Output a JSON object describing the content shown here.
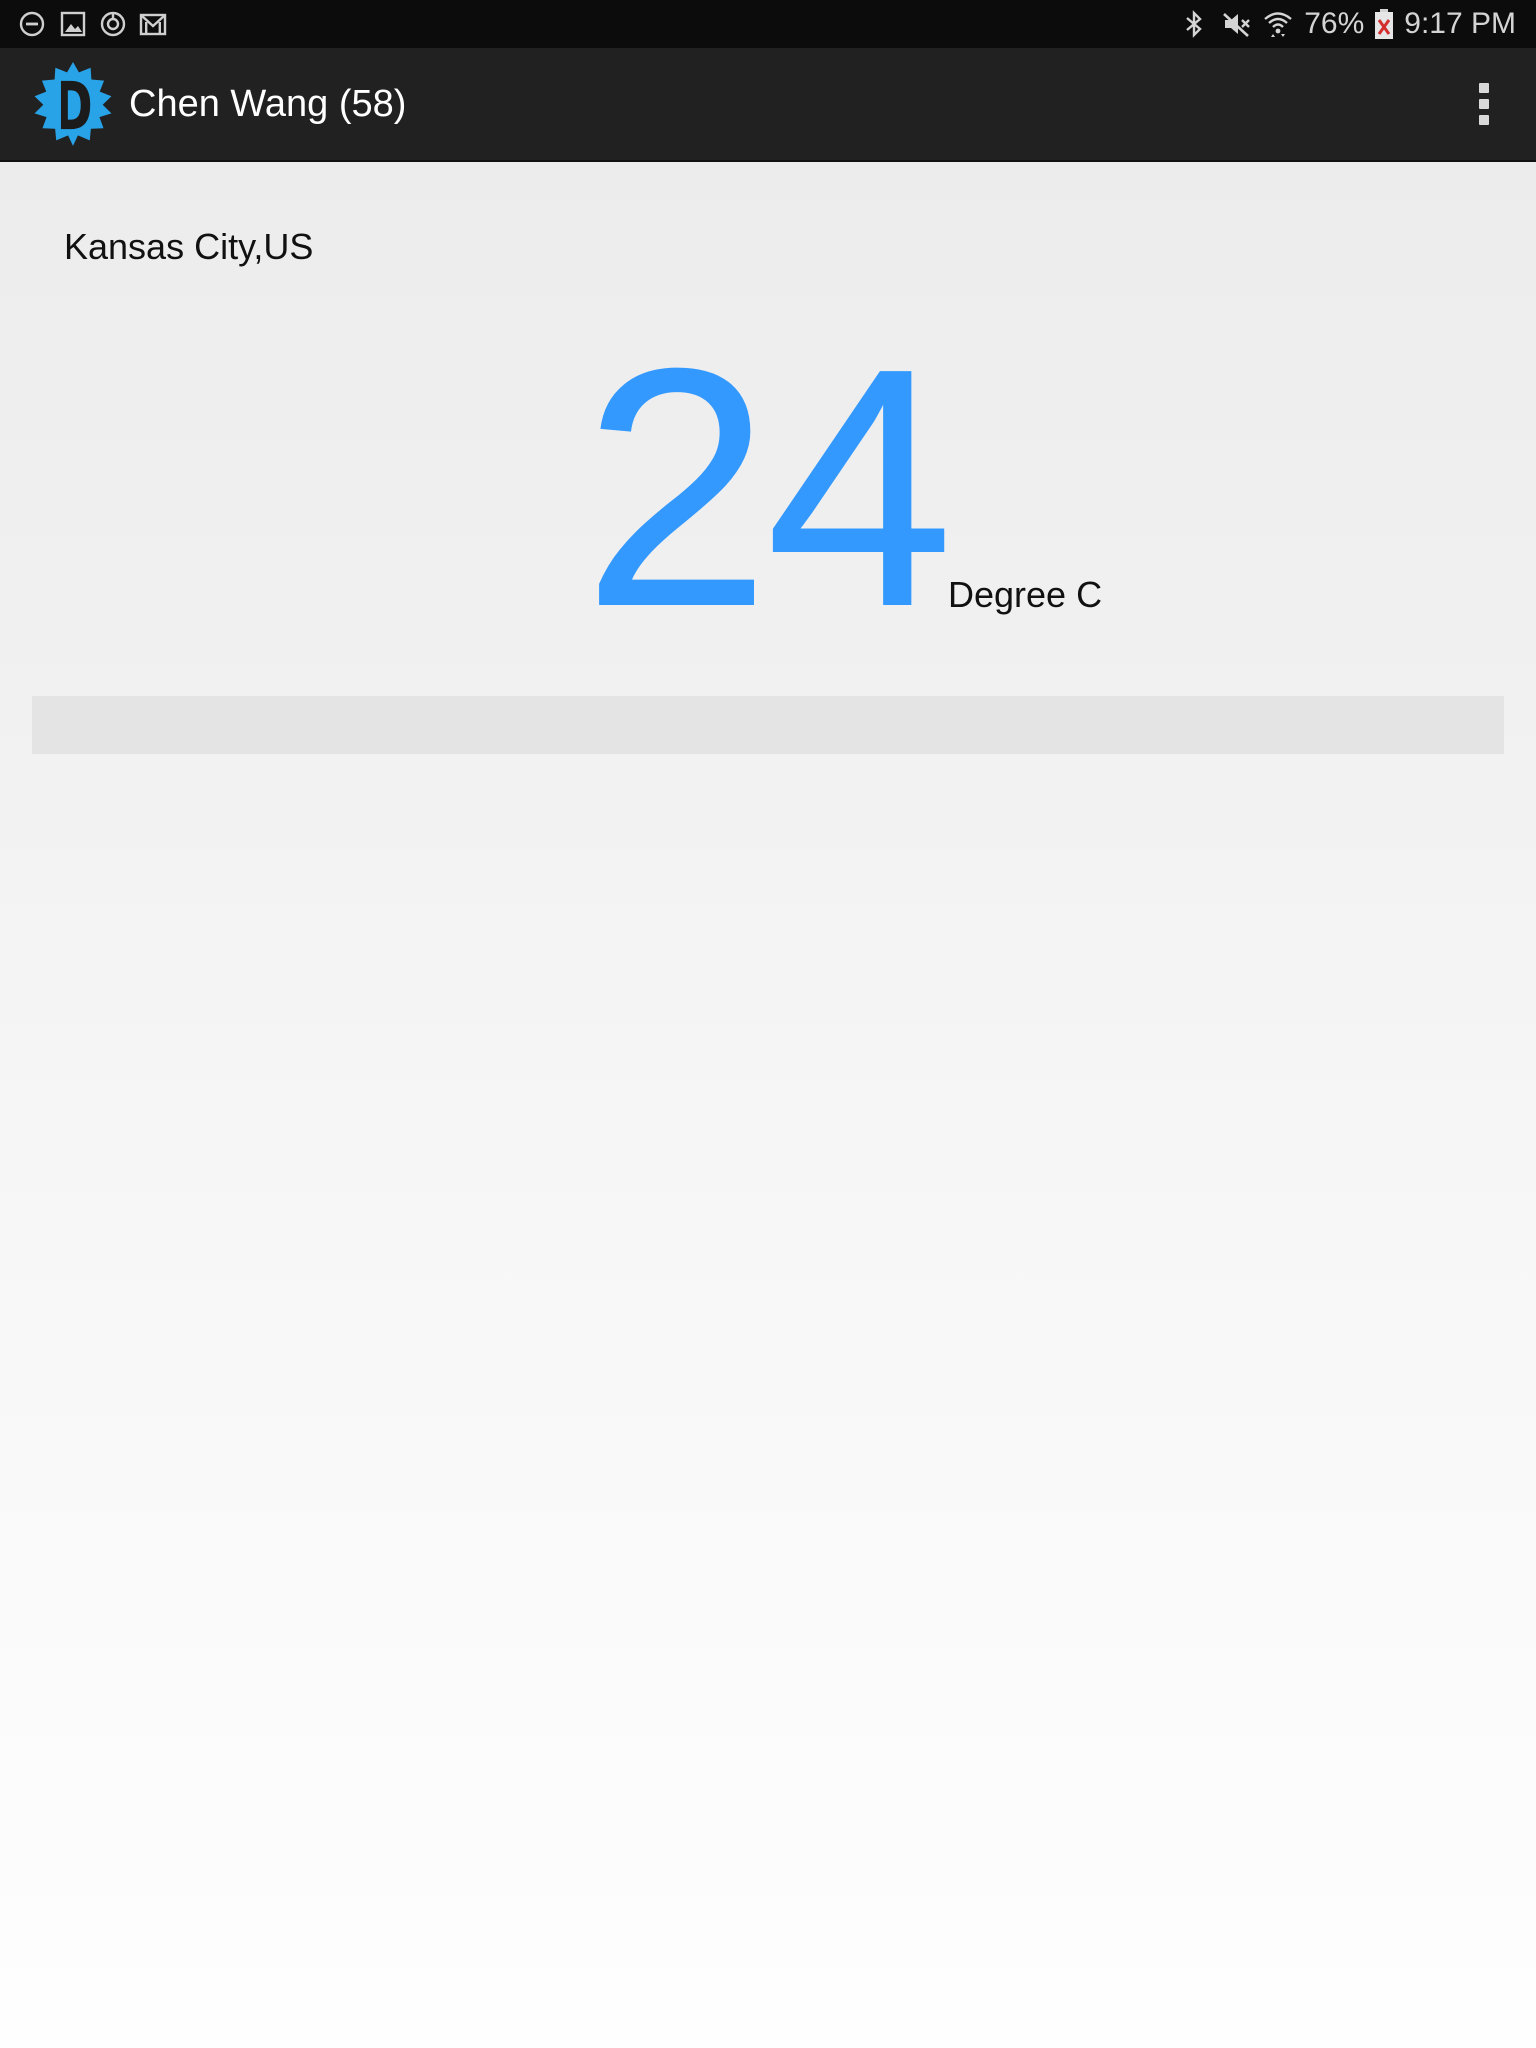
{
  "status_bar": {
    "left_icons": [
      "do-not-disturb-icon",
      "gallery-icon",
      "sync-icon",
      "gmail-icon"
    ],
    "right_icons": [
      "bluetooth-icon",
      "mute-icon",
      "wifi-icon"
    ],
    "battery": "76%",
    "time": "9:17 PM"
  },
  "action_bar": {
    "title": "Chen Wang (58)",
    "logo_icon": "sun-logo-icon",
    "menu_icon": "overflow-menu-icon"
  },
  "weather": {
    "location": "Kansas City,US",
    "temperature": "24",
    "unit": "Degree C"
  },
  "colors": {
    "accent": "#3399ff",
    "logo": "#29a3e8",
    "action_bar": "#212121",
    "status_bar": "#0c0c0c"
  }
}
